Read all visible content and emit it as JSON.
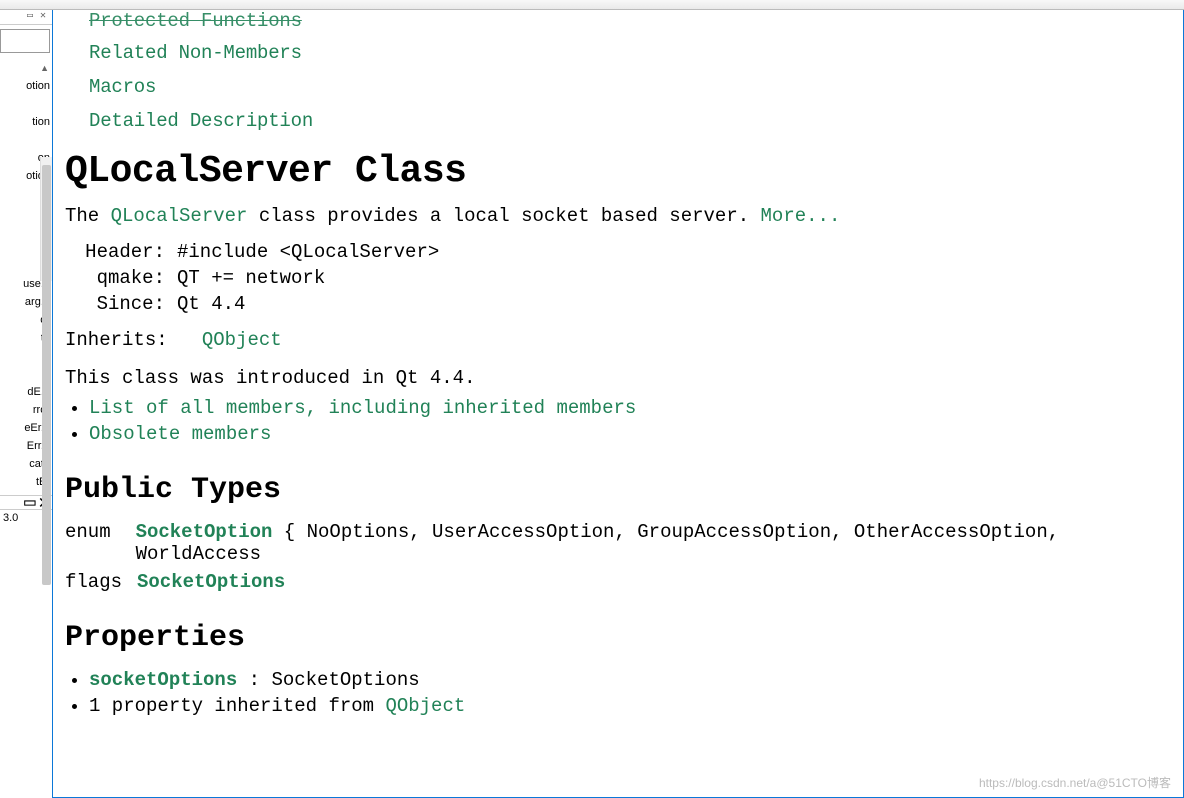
{
  "toc": {
    "protected_functions": "Protected Functions",
    "related_non_members": "Related Non-Members",
    "macros": "Macros",
    "detailed_description": "Detailed Description"
  },
  "title": "QLocalServer Class",
  "summary": {
    "pre": "The ",
    "class_link": "QLocalServer",
    "post": " class provides a local socket based server. ",
    "more": "More..."
  },
  "info": {
    "header_k": "Header:",
    "header_v": "#include <QLocalServer>",
    "qmake_k": "qmake:",
    "qmake_v": "QT += network",
    "since_k": "Since:",
    "since_v": "Qt 4.4"
  },
  "inherits": {
    "label": "Inherits:",
    "value": "QObject"
  },
  "introduced": "This class was introduced in Qt 4.4.",
  "lists": {
    "all_members": "List of all members, including inherited members",
    "obsolete": "Obsolete members"
  },
  "public_types_heading": "Public Types",
  "types": {
    "enum_k": "enum",
    "enum_name": "SocketOption",
    "enum_vals": " { NoOptions, UserAccessOption, GroupAccessOption, OtherAccessOption, WorldAccess",
    "flags_k": "flags",
    "flags_name": "SocketOptions"
  },
  "properties_heading": "Properties",
  "properties": {
    "prop_name": "socketOptions",
    "prop_type": " : SocketOptions",
    "inherited_pre": "1 property inherited from ",
    "inherited_link": "QObject"
  },
  "sidebar": {
    "items": [
      "otion",
      "",
      "tion",
      "",
      "on",
      "otion",
      "",
      "",
      "e",
      "e",
      "r",
      "use...",
      "arg...",
      "or",
      "te",
      "",
      "r",
      "dE...",
      "rror",
      "eEr...",
      "Err...",
      "cate",
      "tEr"
    ],
    "lower": "3.0"
  },
  "watermark": "https://blog.csdn.net/a@51CTO博客"
}
